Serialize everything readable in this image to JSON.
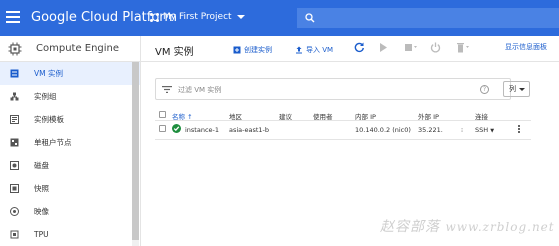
{
  "topbar": {
    "brand": "Google Cloud Platform",
    "project": "My First Project"
  },
  "sidebar": {
    "title": "Compute Engine",
    "items": [
      {
        "label": "VM 实例",
        "icon": "vm-instance-icon",
        "active": true
      },
      {
        "label": "实例组",
        "icon": "instance-group-icon"
      },
      {
        "label": "实例模板",
        "icon": "instance-template-icon"
      },
      {
        "label": "单租户节点",
        "icon": "sole-tenant-icon"
      },
      {
        "label": "磁盘",
        "icon": "disk-icon"
      },
      {
        "label": "快照",
        "icon": "snapshot-icon"
      },
      {
        "label": "映像",
        "icon": "image-icon"
      },
      {
        "label": "TPU",
        "icon": "tpu-icon"
      }
    ]
  },
  "main": {
    "title": "VM 实例",
    "toolbar": {
      "create": "创建实例",
      "import": "导入 VM",
      "show_panel": "显示信息面板"
    },
    "filter_placeholder": "过滤 VM 实例",
    "columns_button": "列",
    "table": {
      "headers": [
        "名称",
        "地区",
        "建议",
        "使用者",
        "内部 IP",
        "外部 IP",
        "连接"
      ],
      "rows": [
        {
          "name": "instance-1",
          "zone": "asia-east1-b",
          "recommendation": "",
          "in_use_by": "",
          "internal_ip": "10.140.0.2 (nic0)",
          "external_ip": "35.221.",
          "connect": "SSH",
          "status": "running"
        }
      ]
    }
  },
  "watermark": {
    "text": "赵容部落",
    "url": "www.zrblog.net"
  },
  "colors": {
    "topbar": "#2d6bdc",
    "accent": "#1a5ccc",
    "status_running": "#1e8e3e"
  }
}
